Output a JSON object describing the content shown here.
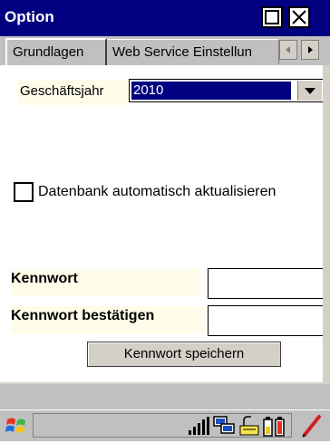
{
  "window": {
    "title": "Option"
  },
  "tabs": [
    {
      "label": "Grundlagen",
      "active": true
    },
    {
      "label": "Web Service Einstellun",
      "active": false
    }
  ],
  "form": {
    "fiscal_year_label": "Geschäftsjahr",
    "fiscal_year_value": "2010",
    "auto_update_label": "Datenbank automatisch aktualisieren",
    "auto_update_checked": false,
    "password_label": "Kennwort",
    "password_value": "",
    "confirm_password_label": "Kennwort bestätigen",
    "confirm_password_value": "",
    "save_password_label": "Kennwort speichern"
  },
  "icons": {
    "start": "windows-start-icon",
    "signal": "signal-strength-icon",
    "network": "network-icon",
    "keyboard": "keyboard-icon",
    "battery": "battery-icon",
    "pen": "pen-icon"
  },
  "colors": {
    "titlebar": "#000080",
    "selection": "#000080",
    "label_background": "#fffde9",
    "chrome": "#c0c0c0"
  }
}
